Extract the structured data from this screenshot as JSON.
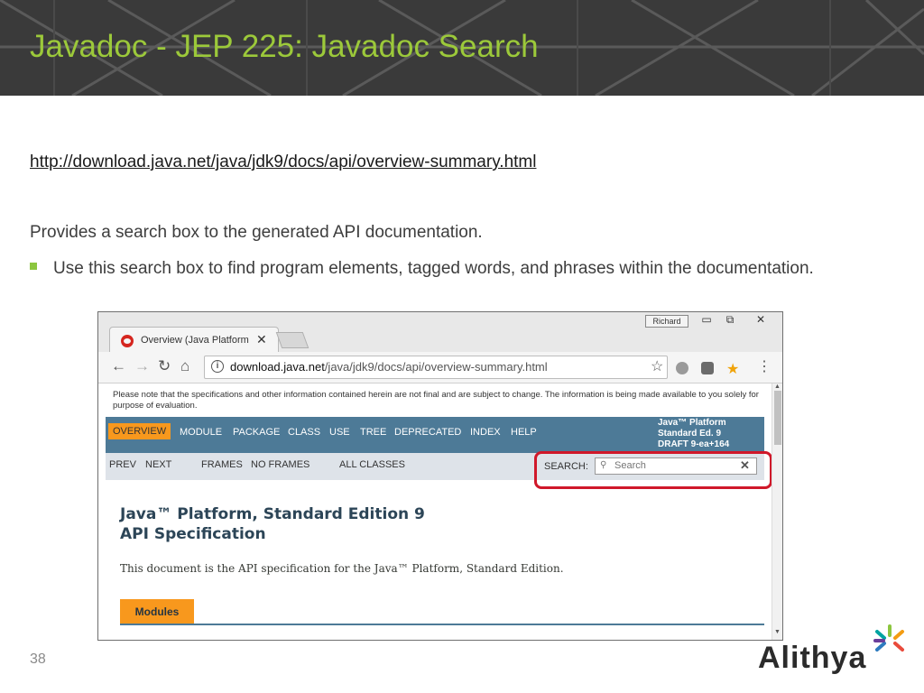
{
  "slide": {
    "title": "Javadoc - JEP 225: Javadoc Search",
    "link": "http://download.java.net/java/jdk9/docs/api/overview-summary.html",
    "body": "Provides a search box to the generated API documentation.",
    "bullet": "Use this search box to find program elements, tagged words, and phrases within the documentation.",
    "page_number": "38",
    "logo_text": "Alithya",
    "title_color": "#9cc93a",
    "bullet_color": "#8cc63f"
  },
  "browser": {
    "tab_title": "Overview (Java Platform",
    "tab_close": "✕",
    "user_badge": "Richard",
    "window_controls": {
      "minimize": "▭",
      "restore": "⧉",
      "close": "✕"
    },
    "nav": {
      "back": "←",
      "forward": "→",
      "reload": "↻",
      "home": "⌂"
    },
    "url_host": "download.java.net",
    "url_path": "/java/jdk9/docs/api/overview-summary.html",
    "star": "☆",
    "menu": "⋮"
  },
  "page": {
    "notice": "Please note that the specifications and other information contained herein are not final and are subject to change. The information is being made available to you solely for purpose of evaluation.",
    "navbar": {
      "items": [
        "OVERVIEW",
        "MODULE",
        "PACKAGE",
        "CLASS",
        "USE",
        "TREE",
        "DEPRECATED",
        "INDEX",
        "HELP"
      ],
      "platform_line1": "Java™ Platform",
      "platform_line2": "Standard Ed. 9",
      "platform_line3": "DRAFT 9-ea+164"
    },
    "subnav": {
      "prev": "PREV",
      "next": "NEXT",
      "frames": "FRAMES",
      "no_frames": "NO FRAMES",
      "all_classes": "ALL CLASSES",
      "search_label": "SEARCH:",
      "search_placeholder": "Search",
      "search_clear": "✕"
    },
    "title_line1": "Java™ Platform, Standard Edition 9",
    "title_line2": "API Specification",
    "description": "This document is the API specification for the Java™ Platform, Standard Edition.",
    "modules_tab": "Modules",
    "accent_colors": {
      "navbar": "#4d7a97",
      "active": "#f8981d",
      "highlight": "#d0182a"
    }
  }
}
